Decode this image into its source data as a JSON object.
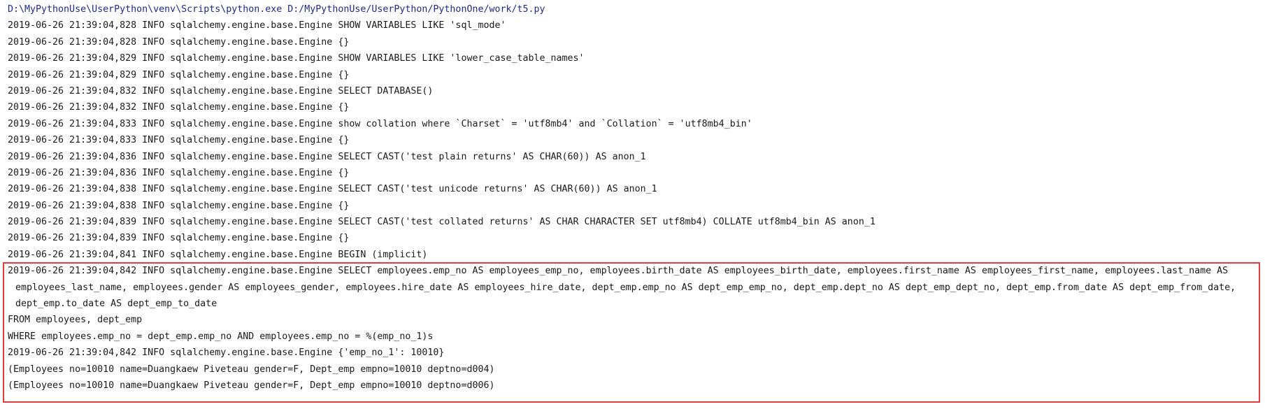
{
  "console": {
    "command": "D:\\MyPythonUse\\UserPython\\venv\\Scripts\\python.exe D:/MyPythonUse/UserPython/PythonOne/work/t5.py",
    "log_lines": [
      "2019-06-26 21:39:04,828 INFO sqlalchemy.engine.base.Engine SHOW VARIABLES LIKE 'sql_mode'",
      "2019-06-26 21:39:04,828 INFO sqlalchemy.engine.base.Engine {}",
      "2019-06-26 21:39:04,829 INFO sqlalchemy.engine.base.Engine SHOW VARIABLES LIKE 'lower_case_table_names'",
      "2019-06-26 21:39:04,829 INFO sqlalchemy.engine.base.Engine {}",
      "2019-06-26 21:39:04,832 INFO sqlalchemy.engine.base.Engine SELECT DATABASE()",
      "2019-06-26 21:39:04,832 INFO sqlalchemy.engine.base.Engine {}",
      "2019-06-26 21:39:04,833 INFO sqlalchemy.engine.base.Engine show collation where `Charset` = 'utf8mb4' and `Collation` = 'utf8mb4_bin'",
      "2019-06-26 21:39:04,833 INFO sqlalchemy.engine.base.Engine {}",
      "2019-06-26 21:39:04,836 INFO sqlalchemy.engine.base.Engine SELECT CAST('test plain returns' AS CHAR(60)) AS anon_1",
      "2019-06-26 21:39:04,836 INFO sqlalchemy.engine.base.Engine {}",
      "2019-06-26 21:39:04,838 INFO sqlalchemy.engine.base.Engine SELECT CAST('test unicode returns' AS CHAR(60)) AS anon_1",
      "2019-06-26 21:39:04,838 INFO sqlalchemy.engine.base.Engine {}",
      "2019-06-26 21:39:04,839 INFO sqlalchemy.engine.base.Engine SELECT CAST('test collated returns' AS CHAR CHARACTER SET utf8mb4) COLLATE utf8mb4_bin AS anon_1",
      "2019-06-26 21:39:04,839 INFO sqlalchemy.engine.base.Engine {}",
      "2019-06-26 21:39:04,841 INFO sqlalchemy.engine.base.Engine BEGIN (implicit)"
    ],
    "highlighted": {
      "select_line_1": "2019-06-26 21:39:04,842 INFO sqlalchemy.engine.base.Engine SELECT employees.emp_no AS employees_emp_no, employees.birth_date AS employees_birth_date, employees.first_name AS employees_first_name, employees.last_name AS",
      "select_line_2": "employees_last_name, employees.gender AS employees_gender, employees.hire_date AS employees_hire_date, dept_emp.emp_no AS dept_emp_emp_no, dept_emp.dept_no AS dept_emp_dept_no, dept_emp.from_date AS dept_emp_from_date,",
      "select_line_3": "dept_emp.to_date AS dept_emp_to_date",
      "from_line": "FROM employees, dept_emp",
      "where_line": "WHERE employees.emp_no = dept_emp.emp_no AND employees.emp_no = %(emp_no_1)s",
      "params_line": "2019-06-26 21:39:04,842 INFO sqlalchemy.engine.base.Engine {'emp_no_1': 10010}",
      "result_line_1": "(Employees no=10010 name=Duangkaew Piveteau gender=F, Dept_emp empno=10010 deptno=d004)",
      "result_line_2": "(Employees no=10010 name=Duangkaew Piveteau gender=F, Dept_emp empno=10010 deptno=d006)",
      "dash_line": "_ _ _ _ _ _ _ _ _ _ _ _ _ _ _ _ _ _ _ _ _ _ _ _ _ _ _ _ _ _ _"
    }
  },
  "colors": {
    "command_text": "#1f2a8a",
    "log_text": "#1a1a1a",
    "highlight_border": "#e83a3a",
    "background": "#ffffff"
  }
}
